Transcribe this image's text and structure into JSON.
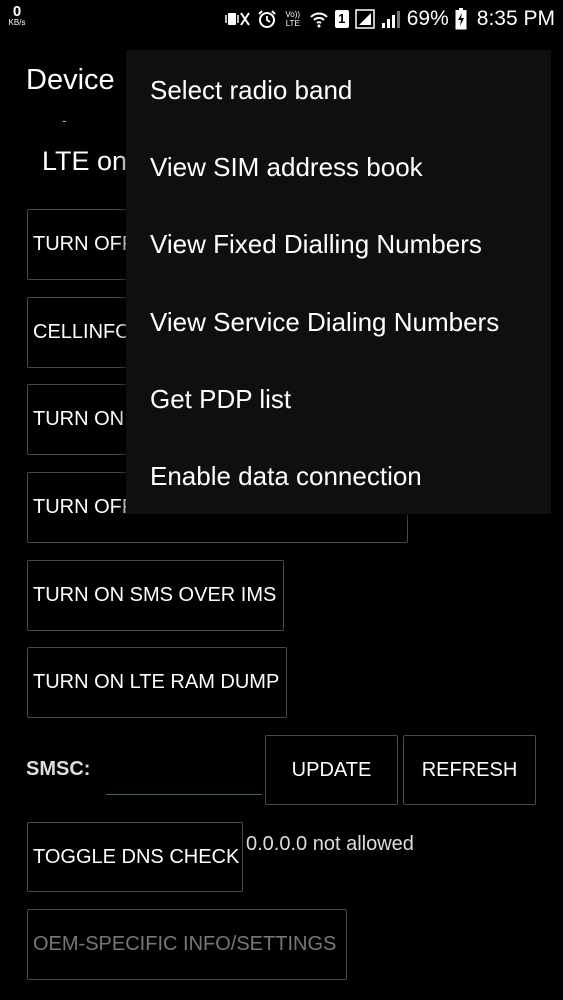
{
  "status_bar": {
    "speed_value": "0",
    "speed_unit": "KB/s",
    "volte_label": "Vo)) LTE",
    "sim_badge": "1",
    "battery": "69%",
    "time": "8:35 PM",
    "icons": [
      "mute-vibrate-icon",
      "alarm-icon",
      "volte-icon",
      "wifi-icon",
      "sim-badge-icon",
      "signal-box-icon",
      "signal-icon",
      "battery-charging-icon"
    ]
  },
  "background": {
    "title": "Device",
    "lte_text": "LTE on",
    "buttons": {
      "turn_off_1": "TURN OFF",
      "cellinfo": "CELLINFO",
      "turn_on_1": "TURN ON",
      "turn_off_provisioned": "TURN OFF VOLTE PROVISIONED FLAG",
      "sms_over_ims": "TURN ON SMS OVER IMS",
      "lte_ram_dump": "TURN ON LTE RAM DUMP",
      "update": "UPDATE",
      "refresh": "REFRESH",
      "toggle_dns": "TOGGLE DNS CHECK",
      "oem_settings": "OEM-SPECIFIC INFO/SETTINGS"
    },
    "smsc_label": "SMSC:",
    "smsc_value": "",
    "dns_status": "0.0.0.0 not allowed"
  },
  "menu": {
    "items": [
      {
        "label": "Select radio band"
      },
      {
        "label": "View SIM address book"
      },
      {
        "label": "View Fixed Dialling Numbers"
      },
      {
        "label": "View Service Dialing Numbers"
      },
      {
        "label": "Get PDP list"
      },
      {
        "label": "Enable data connection"
      }
    ]
  },
  "colors": {
    "background": "#000000",
    "menu_background": "#0f0f0f",
    "text": "#ffffff",
    "disabled_text": "#777777",
    "button_border": "#4a4a4a"
  }
}
